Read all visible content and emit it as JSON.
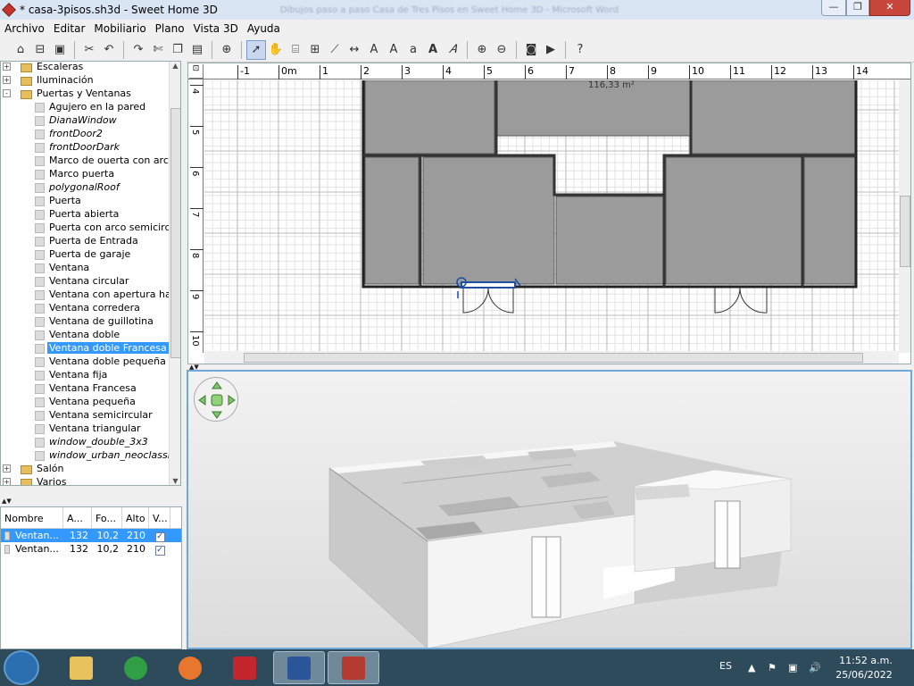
{
  "window": {
    "title": "* casa-3pisos.sh3d - Sweet Home 3D",
    "blurred_title": "Dibujos paso a paso Casa de Tres Pisos en Sweet Home 3D - Microsoft Word"
  },
  "menu": [
    "Archivo",
    "Editar",
    "Mobiliario",
    "Plano",
    "Vista 3D",
    "Ayuda"
  ],
  "toolbar": [
    "new-home-icon",
    "open-icon",
    "save-icon",
    "cut-scissors-icon",
    "undo-icon",
    "redo-icon",
    "cut-icon",
    "copy-icon",
    "paste-icon",
    "add-furniture-icon",
    "select-arrow-icon",
    "pan-hand-icon",
    "create-walls-icon",
    "create-rooms-icon",
    "create-polylines-icon",
    "create-dimensions-icon",
    "add-text-icon",
    "increase-text-icon",
    "decrease-text-icon",
    "bold-text-icon",
    "italic-text-icon",
    "zoom-in-icon",
    "zoom-out-icon",
    "photo-icon",
    "video-icon",
    "help-icon"
  ],
  "tree": {
    "rows": [
      {
        "label": "Escaleras",
        "type": "folder",
        "exp": "+",
        "indent": 0,
        "italic": false,
        "selected": false
      },
      {
        "label": "Iluminación",
        "type": "folder",
        "exp": "+",
        "indent": 0,
        "italic": false,
        "selected": false
      },
      {
        "label": "Puertas y Ventanas",
        "type": "folder",
        "exp": "-",
        "indent": 0,
        "italic": false,
        "selected": false
      },
      {
        "label": "Agujero en la pared",
        "type": "item",
        "indent": 1,
        "italic": false,
        "selected": false
      },
      {
        "label": "DianaWindow",
        "type": "item",
        "indent": 1,
        "italic": true,
        "selected": false
      },
      {
        "label": "frontDoor2",
        "type": "item",
        "indent": 1,
        "italic": true,
        "selected": false
      },
      {
        "label": "frontDoorDark",
        "type": "item",
        "indent": 1,
        "italic": true,
        "selected": false
      },
      {
        "label": "Marco de ouerta con arco s",
        "type": "item",
        "indent": 1,
        "italic": false,
        "selected": false
      },
      {
        "label": "Marco puerta",
        "type": "item",
        "indent": 1,
        "italic": false,
        "selected": false
      },
      {
        "label": "polygonalRoof",
        "type": "item",
        "indent": 1,
        "italic": true,
        "selected": false
      },
      {
        "label": "Puerta",
        "type": "item",
        "indent": 1,
        "italic": false,
        "selected": false
      },
      {
        "label": "Puerta abierta",
        "type": "item",
        "indent": 1,
        "italic": false,
        "selected": false
      },
      {
        "label": "Puerta con arco semicircula",
        "type": "item",
        "indent": 1,
        "italic": false,
        "selected": false
      },
      {
        "label": "Puerta de Entrada",
        "type": "item",
        "indent": 1,
        "italic": false,
        "selected": false
      },
      {
        "label": "Puerta de garaje",
        "type": "item",
        "indent": 1,
        "italic": false,
        "selected": false
      },
      {
        "label": "Ventana",
        "type": "item",
        "indent": 1,
        "italic": false,
        "selected": false
      },
      {
        "label": "Ventana circular",
        "type": "item",
        "indent": 1,
        "italic": false,
        "selected": false
      },
      {
        "label": "Ventana con apertura hacia",
        "type": "item",
        "indent": 1,
        "italic": false,
        "selected": false
      },
      {
        "label": "Ventana corredera",
        "type": "item",
        "indent": 1,
        "italic": false,
        "selected": false
      },
      {
        "label": "Ventana de guillotina",
        "type": "item",
        "indent": 1,
        "italic": false,
        "selected": false
      },
      {
        "label": "Ventana doble",
        "type": "item",
        "indent": 1,
        "italic": false,
        "selected": false
      },
      {
        "label": "Ventana doble Francesa",
        "type": "item",
        "indent": 1,
        "italic": false,
        "selected": true
      },
      {
        "label": "Ventana doble pequeña",
        "type": "item",
        "indent": 1,
        "italic": false,
        "selected": false
      },
      {
        "label": "Ventana fija",
        "type": "item",
        "indent": 1,
        "italic": false,
        "selected": false
      },
      {
        "label": "Ventana Francesa",
        "type": "item",
        "indent": 1,
        "italic": false,
        "selected": false
      },
      {
        "label": "Ventana pequeña",
        "type": "item",
        "indent": 1,
        "italic": false,
        "selected": false
      },
      {
        "label": "Ventana semicircular",
        "type": "item",
        "indent": 1,
        "italic": false,
        "selected": false
      },
      {
        "label": "Ventana triangular",
        "type": "item",
        "indent": 1,
        "italic": false,
        "selected": false
      },
      {
        "label": "window_double_3x3",
        "type": "item",
        "indent": 1,
        "italic": true,
        "selected": false
      },
      {
        "label": "window_urban_neoclassic",
        "type": "item",
        "indent": 1,
        "italic": true,
        "selected": false
      },
      {
        "label": "Salón",
        "type": "folder",
        "exp": "+",
        "indent": 0,
        "italic": false,
        "selected": false
      },
      {
        "label": "Varios",
        "type": "folder",
        "exp": "+",
        "indent": 0,
        "italic": false,
        "selected": false
      }
    ]
  },
  "furniture_table": {
    "headers": [
      "Nombre",
      "A...",
      "Fo...",
      "Alto",
      "V..."
    ],
    "rows": [
      {
        "name": "Ventan...",
        "width": "132",
        "depth": "10,2",
        "height": "210",
        "visible": true,
        "selected": true
      },
      {
        "name": "Ventan...",
        "width": "132",
        "depth": "10,2",
        "height": "210",
        "visible": true,
        "selected": false
      }
    ]
  },
  "plan": {
    "ruler_top": [
      "-1",
      "0m",
      "1",
      "2",
      "3",
      "4",
      "5",
      "6",
      "7",
      "8",
      "9",
      "10",
      "11",
      "12",
      "13",
      "14"
    ],
    "ruler_left": [
      "4",
      "5",
      "6",
      "7",
      "8",
      "9",
      "10"
    ],
    "area_label": "116,33 m²"
  },
  "taskbar": {
    "lang": "ES",
    "time": "11:52 a.m.",
    "date": "25/06/2022",
    "apps": [
      "explorer-icon",
      "chrome-icon",
      "firefox-icon",
      "app-red-icon",
      "word-icon",
      "sweethome3d-icon"
    ]
  },
  "colors": {
    "selection": "#3399ff",
    "room_fill": "#9a9a9a",
    "window_frame": "#6fa7d8"
  }
}
